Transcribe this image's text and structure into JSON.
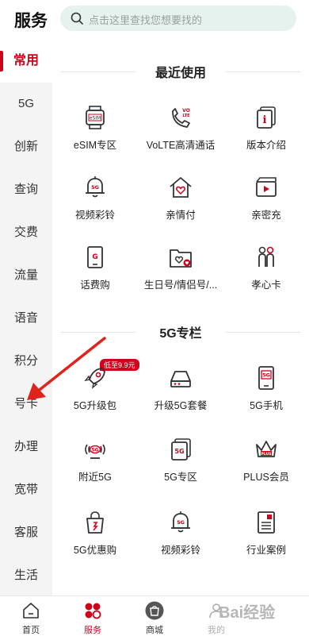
{
  "header": {
    "title": "服务",
    "search_placeholder": "点击这里查找您想要找的"
  },
  "sidebar": {
    "items": [
      {
        "label": "常用",
        "active": true
      },
      {
        "label": "5G"
      },
      {
        "label": "创新"
      },
      {
        "label": "查询"
      },
      {
        "label": "交费"
      },
      {
        "label": "流量"
      },
      {
        "label": "语音"
      },
      {
        "label": "积分"
      },
      {
        "label": "号卡"
      },
      {
        "label": "办理"
      },
      {
        "label": "宽带"
      },
      {
        "label": "客服"
      },
      {
        "label": "生活"
      }
    ]
  },
  "sections": {
    "recent": {
      "title": "最近使用",
      "items": [
        {
          "label": "eSIM专区",
          "icon": "esim-watch-icon"
        },
        {
          "label": "VoLTE高清通话",
          "icon": "volte-phone-icon"
        },
        {
          "label": "版本介绍",
          "icon": "info-doc-icon"
        },
        {
          "label": "视频彩铃",
          "icon": "bell-5g-icon"
        },
        {
          "label": "亲情付",
          "icon": "home-heart-icon"
        },
        {
          "label": "亲密充",
          "icon": "video-card-icon"
        },
        {
          "label": "话费购",
          "icon": "phone-g-icon"
        },
        {
          "label": "生日号/情侣号/...",
          "icon": "folder-heart-icon"
        },
        {
          "label": "孝心卡",
          "icon": "family-icon"
        }
      ]
    },
    "fiveg": {
      "title": "5G专栏",
      "badge": "低至9.9元",
      "items": [
        {
          "label": "5G升级包",
          "icon": "rocket-icon"
        },
        {
          "label": "升级5G套餐",
          "icon": "router-icon"
        },
        {
          "label": "5G手机",
          "icon": "phone-5g-icon"
        },
        {
          "label": "附近5G",
          "icon": "signal-5g-icon"
        },
        {
          "label": "5G专区",
          "icon": "stack-5g-icon"
        },
        {
          "label": "PLUS会员",
          "icon": "crown-plus-icon"
        },
        {
          "label": "5G优惠购",
          "icon": "bag-icon"
        },
        {
          "label": "视频彩铃",
          "icon": "bell-5g-icon"
        },
        {
          "label": "行业案例",
          "icon": "book-icon"
        }
      ]
    }
  },
  "bottom_nav": [
    {
      "label": "首页"
    },
    {
      "label": "服务",
      "active": true
    },
    {
      "label": "商城"
    },
    {
      "label": "我的"
    }
  ],
  "watermark": "Bai经验",
  "colors": {
    "accent": "#d0021b",
    "search_bg": "#e6f2ee"
  }
}
